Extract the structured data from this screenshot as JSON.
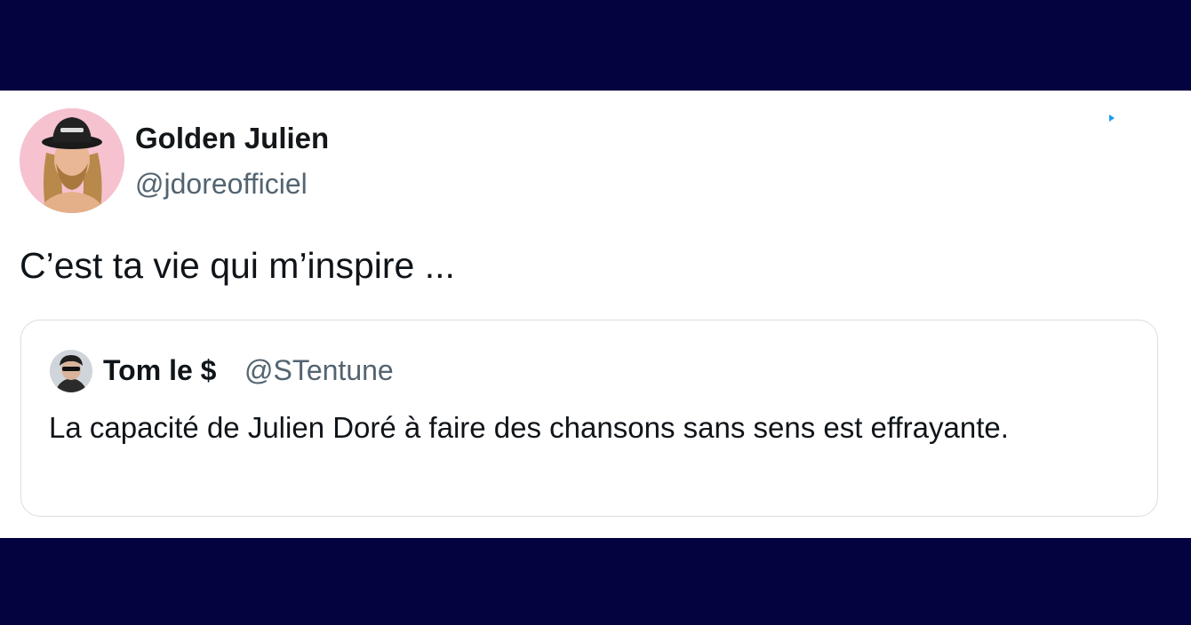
{
  "tweet": {
    "author": {
      "display_name": "Golden Julien",
      "handle": "@jdoreofficiel",
      "avatar_icon": "profile-photo"
    },
    "text": "C’est ta vie qui m’inspire ...",
    "more_icon": "caret-icon",
    "quoted": {
      "author": {
        "display_name": "Tom le $",
        "handle": "@STentune",
        "avatar_icon": "profile-photo"
      },
      "text": "La capacité de Julien Doré à faire des chansons sans sens est effrayante."
    }
  },
  "colors": {
    "frame": "#05033f",
    "card": "#ffffff",
    "text": "#0f1419",
    "secondary": "#536471",
    "border": "#d8dee3",
    "accent": "#1d9bf0"
  }
}
